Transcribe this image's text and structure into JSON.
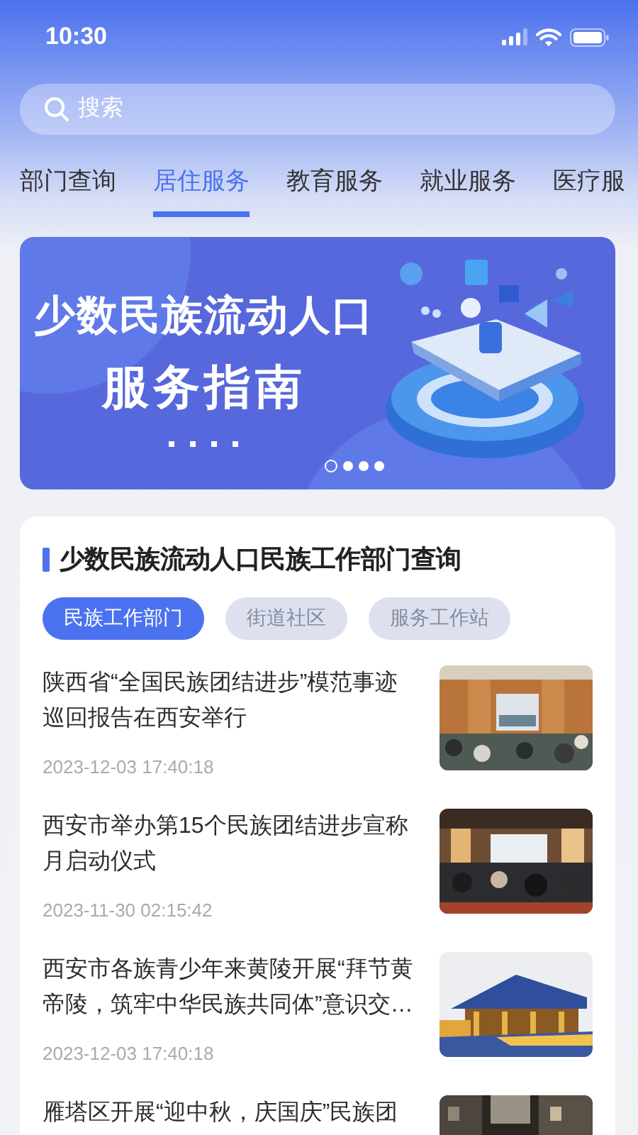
{
  "status_bar": {
    "time": "10:30"
  },
  "search": {
    "placeholder": "搜索"
  },
  "tabs": [
    {
      "label": "部门查询",
      "selected": false
    },
    {
      "label": "居住服务",
      "selected": true
    },
    {
      "label": "教育服务",
      "selected": false
    },
    {
      "label": "就业服务",
      "selected": false
    },
    {
      "label": "医疗服",
      "selected": false
    }
  ],
  "banner": {
    "title_line_1": "少数民族流动人口",
    "title_line_2": "服务指南",
    "pages": [
      {
        "selected": true
      },
      {
        "selected": false
      },
      {
        "selected": false
      },
      {
        "selected": false
      }
    ]
  },
  "section": {
    "title": "少数民族流动人口民族工作部门查询",
    "filters": [
      {
        "label": "民族工作部门",
        "selected": true
      },
      {
        "label": "街道社区",
        "selected": false
      },
      {
        "label": "服务工作站",
        "selected": false
      }
    ],
    "news": [
      {
        "title": "陕西省“全国民族团结进步”模范事迹巡回报告在西安举行",
        "date": "2023-12-03 17:40:18",
        "kind": "picture"
      },
      {
        "title": "西安市举办第15个民族团结进步宣称月启动仪式",
        "date": "2023-11-30 02:15:42",
        "kind": "picture"
      },
      {
        "title": "西安市各族青少年来黄陵开展“拜节黄帝陵，筑牢中华民族共同体”意识交…",
        "date": "2023-12-03 17:40:18",
        "kind": "picture"
      },
      {
        "title": "雁塔区开展“迎中秋，庆国庆”民族团",
        "kind": "picture"
      }
    ]
  }
}
